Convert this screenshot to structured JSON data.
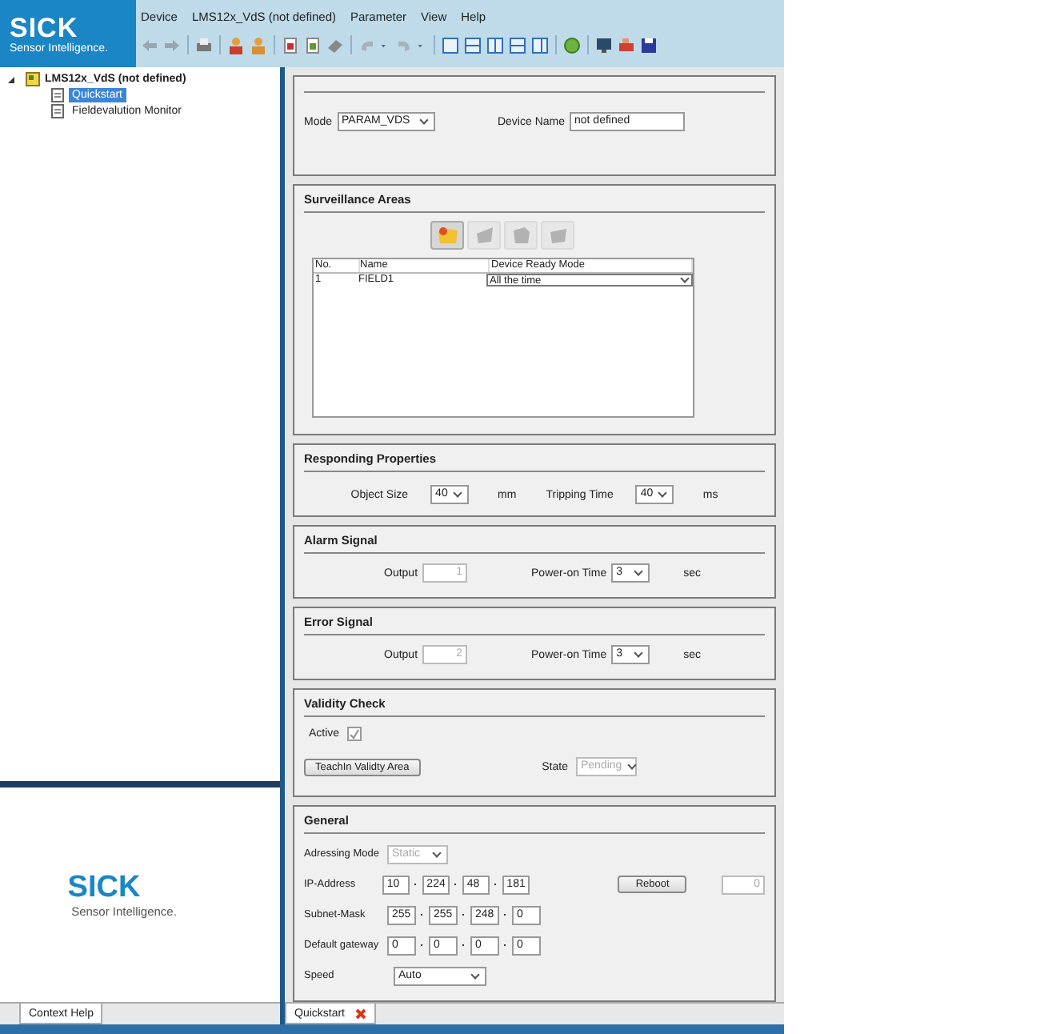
{
  "logo": {
    "brand": "SICK",
    "tagline": "Sensor Intelligence."
  },
  "menu": [
    "Device",
    "LMS12x_VdS (not defined)",
    "Parameter",
    "View",
    "Help"
  ],
  "tree": {
    "label": "LMS12x_VdS (not defined)",
    "expanded": true,
    "children": [
      {
        "label": "Quickstart",
        "selected": true
      },
      {
        "label": "Fieldevalution Monitor",
        "selected": false
      }
    ]
  },
  "help_panel": {
    "brand": "SICK",
    "tagline": "Sensor Intelligence.",
    "tab": "Context Help"
  },
  "device": {
    "mode_label": "Mode",
    "mode": "PARAM_VDS",
    "name_label": "Device Name",
    "name": "not defined"
  },
  "surveillance": {
    "title": "Surveillance Areas",
    "tool_buttons": [
      {
        "kind": "add",
        "disabled": false
      },
      {
        "kind": "edit",
        "disabled": true
      },
      {
        "kind": "copy",
        "disabled": true
      },
      {
        "kind": "delete",
        "disabled": true
      }
    ],
    "columns": [
      "No.",
      "Name",
      "Device Ready Mode"
    ],
    "rows": [
      [
        "1",
        "FIELD1",
        "All the time"
      ]
    ]
  },
  "responding": {
    "title": "Responding Properties",
    "fields": [
      {
        "label": "Object Size",
        "value": "40",
        "unit": "mm"
      },
      {
        "label": "Tripping Time",
        "value": "40",
        "unit": "ms"
      }
    ]
  },
  "signals": [
    {
      "title": "Alarm Signal",
      "output_label": "Output",
      "output": "1",
      "output_disabled": true,
      "time_label": "Power-on Time",
      "time": "3",
      "unit": "sec"
    },
    {
      "title": "Error Signal",
      "output_label": "Output",
      "output": "2",
      "output_disabled": true,
      "time_label": "Power-on Time",
      "time": "3",
      "unit": "sec"
    }
  ],
  "validity": {
    "title": "Validity Check",
    "active_label": "Active",
    "active_checked": true,
    "active_disabled": true,
    "button": "TeachIn Validty Area",
    "state_label": "State",
    "state": "Pending",
    "state_disabled": true
  },
  "general": {
    "title": "General",
    "addressing_label": "Adressing Mode",
    "addressing": "Static",
    "addressing_disabled": true,
    "addresses": [
      {
        "label": "IP-Address",
        "octets": [
          "10",
          "224",
          "48",
          "181"
        ]
      },
      {
        "label": "Subnet-Mask",
        "octets": [
          "255",
          "255",
          "248",
          "0"
        ]
      },
      {
        "label": "Default gateway",
        "octets": [
          "0",
          "0",
          "0",
          "0"
        ]
      }
    ],
    "reboot": "Reboot",
    "reboot_value": "0",
    "reboot_value_disabled": true,
    "speed_label": "Speed",
    "speed": "Auto"
  },
  "main_tab": {
    "label": "Quickstart"
  }
}
